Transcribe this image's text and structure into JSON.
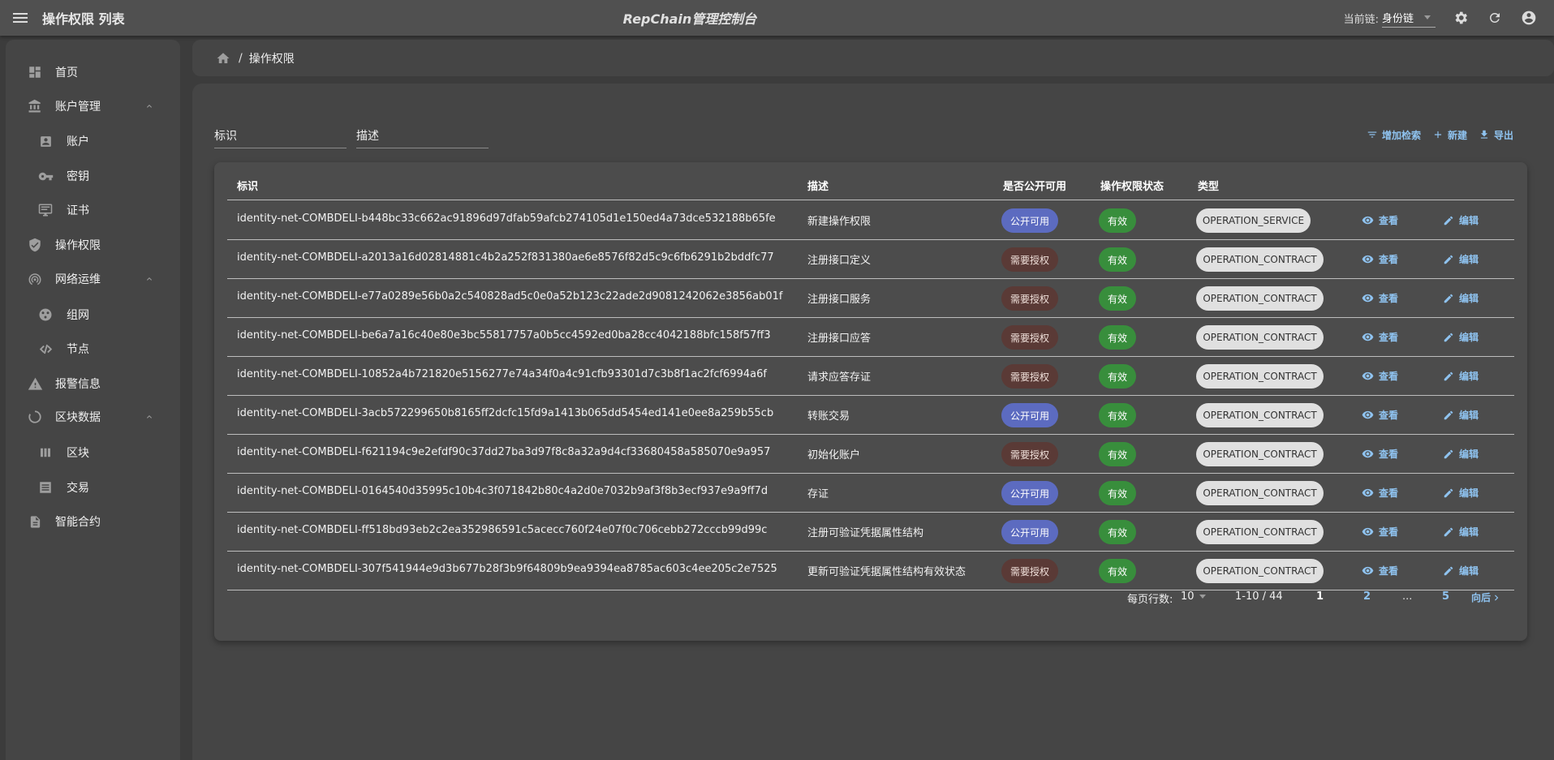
{
  "topbar": {
    "page_heading": "操作权限 列表",
    "app_title": "RepChain管理控制台",
    "chain_label": "当前链:",
    "chain_value": "身份链"
  },
  "sidebar": {
    "items": [
      {
        "label": "首页",
        "icon": "dashboard-icon"
      },
      {
        "label": "账户管理",
        "icon": "bank-icon"
      },
      {
        "label": "账户",
        "icon": "account-box-icon"
      },
      {
        "label": "密钥",
        "icon": "key-icon"
      },
      {
        "label": "证书",
        "icon": "certificate-icon"
      },
      {
        "label": "操作权限",
        "icon": "shield-icon"
      },
      {
        "label": "网络运维",
        "icon": "network-icon"
      },
      {
        "label": "组网",
        "icon": "network-group-icon"
      },
      {
        "label": "节点",
        "icon": "node-link-icon"
      },
      {
        "label": "报警信息",
        "icon": "warning-icon"
      },
      {
        "label": "区块数据",
        "icon": "block-data-icon"
      },
      {
        "label": "区块",
        "icon": "block-icon"
      },
      {
        "label": "交易",
        "icon": "transaction-icon"
      },
      {
        "label": "智能合约",
        "icon": "contract-icon"
      }
    ]
  },
  "breadcrumb": {
    "current": "操作权限",
    "separator": "/"
  },
  "filters": {
    "id_label": "标识",
    "desc_label": "描述"
  },
  "toolbar": {
    "add_filter": "增加检索",
    "create": "新建",
    "export": "导出"
  },
  "table": {
    "headers": {
      "id": "标识",
      "desc": "描述",
      "public": "是否公开可用",
      "status": "操作权限状态",
      "type": "类型"
    },
    "view_label": "查看",
    "edit_label": "编辑",
    "rows": [
      {
        "id": "identity-net-COMBDELI-b448bc33c662ac91896d97dfab59afcb274105d1e150ed4a73dce532188b65fe",
        "desc": "新建操作权限",
        "public": "公开可用",
        "status": "有效",
        "type": "OPERATION_SERVICE"
      },
      {
        "id": "identity-net-COMBDELI-a2013a16d02814881c4b2a252f831380ae6e8576f82d5c9c6fb6291b2bddfc77",
        "desc": "注册接口定义",
        "public": "需要授权",
        "status": "有效",
        "type": "OPERATION_CONTRACT"
      },
      {
        "id": "identity-net-COMBDELI-e77a0289e56b0a2c540828ad5c0e0a52b123c22ade2d9081242062e3856ab01f",
        "desc": "注册接口服务",
        "public": "需要授权",
        "status": "有效",
        "type": "OPERATION_CONTRACT"
      },
      {
        "id": "identity-net-COMBDELI-be6a7a16c40e80e3bc55817757a0b5cc4592ed0ba28cc4042188bfc158f57ff3",
        "desc": "注册接口应答",
        "public": "需要授权",
        "status": "有效",
        "type": "OPERATION_CONTRACT"
      },
      {
        "id": "identity-net-COMBDELI-10852a4b721820e5156277e74a34f0a4c91cfb93301d7c3b8f1ac2fcf6994a6f",
        "desc": "请求应答存证",
        "public": "需要授权",
        "status": "有效",
        "type": "OPERATION_CONTRACT"
      },
      {
        "id": "identity-net-COMBDELI-3acb572299650b8165ff2dcfc15fd9a1413b065dd5454ed141e0ee8a259b55cb",
        "desc": "转账交易",
        "public": "公开可用",
        "status": "有效",
        "type": "OPERATION_CONTRACT"
      },
      {
        "id": "identity-net-COMBDELI-f621194c9e2efdf90c37dd27ba3d97f8c8a32a9d4cf33680458a585070e9a957",
        "desc": "初始化账户",
        "public": "需要授权",
        "status": "有效",
        "type": "OPERATION_CONTRACT"
      },
      {
        "id": "identity-net-COMBDELI-0164540d35995c10b4c3f071842b80c4a2d0e7032b9af3f8b3ecf937e9a9ff7d",
        "desc": "存证",
        "public": "公开可用",
        "status": "有效",
        "type": "OPERATION_CONTRACT"
      },
      {
        "id": "identity-net-COMBDELI-ff518bd93eb2c2ea352986591c5acecc760f24e07f0c706cebb272cccb99d99c",
        "desc": "注册可验证凭据属性结构",
        "public": "公开可用",
        "status": "有效",
        "type": "OPERATION_CONTRACT"
      },
      {
        "id": "identity-net-COMBDELI-307f541944e9d3b677b28f3b9f64809b9ea9394ea8785ac603c4ee205c2e7525",
        "desc": "更新可验证凭据属性结构有效状态",
        "public": "需要授权",
        "status": "有效",
        "type": "OPERATION_CONTRACT"
      }
    ]
  },
  "pagination": {
    "rows_per_page_label": "每页行数:",
    "rows_per_page": "10",
    "range": "1-10 / 44",
    "pages": [
      "1",
      "2",
      "...",
      "5"
    ],
    "next_label": "向后"
  },
  "colors": {
    "accent": "#8fc3f0",
    "public_chip": "#5c6bc0",
    "auth_chip": "#5a3a36",
    "valid_chip": "#388e3c",
    "type_chip": "#e0e0e0"
  }
}
